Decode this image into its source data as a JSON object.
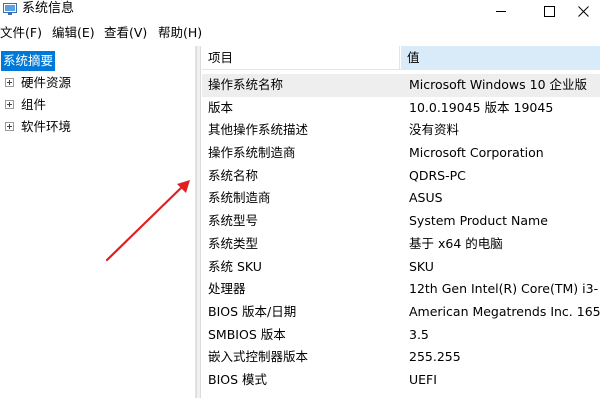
{
  "window": {
    "title": "系统信息",
    "app_icon": "system-info-icon",
    "controls": [
      "minimize-icon",
      "maximize-icon",
      "close-icon"
    ]
  },
  "menu": [
    {
      "label": "文件(F)"
    },
    {
      "label": "编辑(E)"
    },
    {
      "label": "查看(V)"
    },
    {
      "label": "帮助(H)"
    }
  ],
  "tree": {
    "items": [
      {
        "label": "系统摘要",
        "selected": true
      },
      {
        "label": "硬件资源",
        "expandable": true
      },
      {
        "label": "组件",
        "expandable": true
      },
      {
        "label": "软件环境",
        "expandable": true
      }
    ]
  },
  "table": {
    "columns": {
      "item": "项目",
      "value": "值"
    },
    "rows": [
      {
        "item": "操作系统名称",
        "value": "Microsoft Windows 10 企业版"
      },
      {
        "item": "版本",
        "value": "10.0.19045 版本 19045"
      },
      {
        "item": "其他操作系统描述",
        "value": "没有资料"
      },
      {
        "item": "操作系统制造商",
        "value": "Microsoft Corporation"
      },
      {
        "item": "系统名称",
        "value": "QDRS-PC"
      },
      {
        "item": "系统制造商",
        "value": "ASUS"
      },
      {
        "item": "系统型号",
        "value": "System Product Name"
      },
      {
        "item": "系统类型",
        "value": "基于 x64 的电脑"
      },
      {
        "item": "系统 SKU",
        "value": "SKU"
      },
      {
        "item": "处理器",
        "value": "12th Gen Intel(R) Core(TM) i3-"
      },
      {
        "item": "BIOS 版本/日期",
        "value": "American Megatrends Inc. 165"
      },
      {
        "item": "SMBIOS 版本",
        "value": "3.5"
      },
      {
        "item": "嵌入式控制器版本",
        "value": "255.255"
      },
      {
        "item": "BIOS 模式",
        "value": "UEFI"
      }
    ]
  },
  "colors": {
    "selection": "#0078d7",
    "value_header": "#d9ebf9",
    "annotation_arrow": "#e02020"
  }
}
